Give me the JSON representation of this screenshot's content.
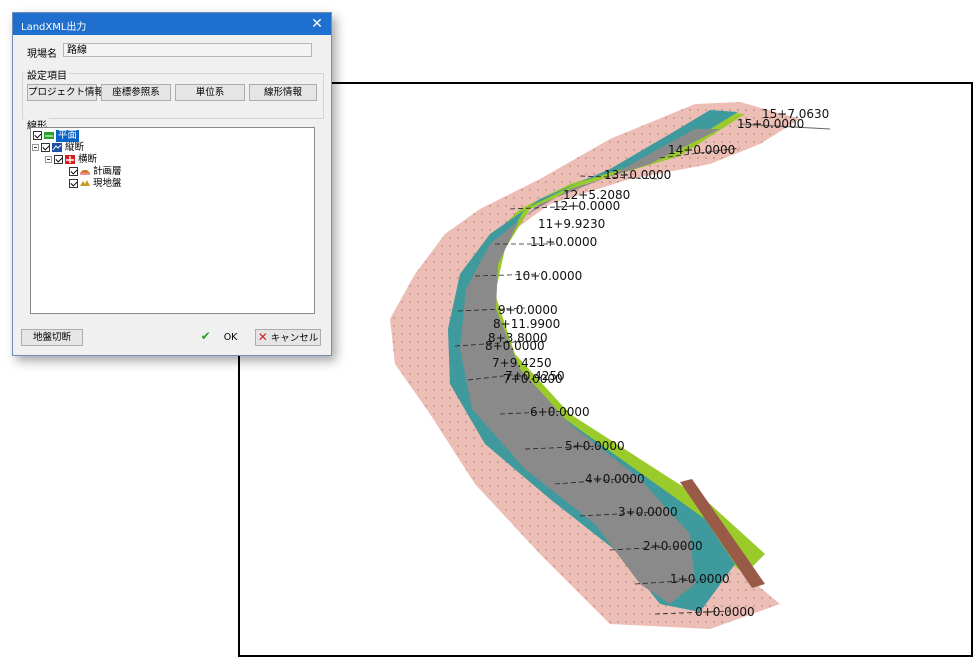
{
  "dialog": {
    "title": "LandXML出力",
    "close_glyph": "✕",
    "site_label": "現場名",
    "site_value": "路線",
    "settings_label": "設定項目",
    "settings_buttons": [
      "プロジェクト情報",
      "座標参照系",
      "単位系",
      "線形情報"
    ],
    "alignment_label": "線形",
    "tree": [
      {
        "label": "平面",
        "icon": "plan-icon",
        "selected": true
      },
      {
        "label": "縦断",
        "icon": "profile-icon",
        "selected": false
      },
      {
        "label": "横断",
        "icon": "cross-section-icon",
        "selected": false
      },
      {
        "label": "計画層",
        "icon": "design-layer-icon",
        "selected": false
      },
      {
        "label": "現地盤",
        "icon": "ground-icon",
        "selected": false
      }
    ],
    "ground_cut_label": "地盤切断",
    "ok_label": "OK",
    "cancel_label": "キャンセル"
  },
  "viewport": {
    "stations": [
      "15+7.0630",
      "15+0.0000",
      "14+0.0000",
      "13+0.0000",
      "12+5.2080",
      "12+0.0000",
      "11+9.9230",
      "11+0.0000",
      "10+0.0000",
      "9+0.0000",
      "8+11.9900",
      "8+3.8000",
      "8+0.0000",
      "7+9.4250",
      "7+0.4250",
      "7+0.0000",
      "6+0.0000",
      "5+0.0000",
      "4+0.0000",
      "3+0.0000",
      "2+0.0000",
      "1+0.0000",
      "0+0.0000"
    ]
  }
}
